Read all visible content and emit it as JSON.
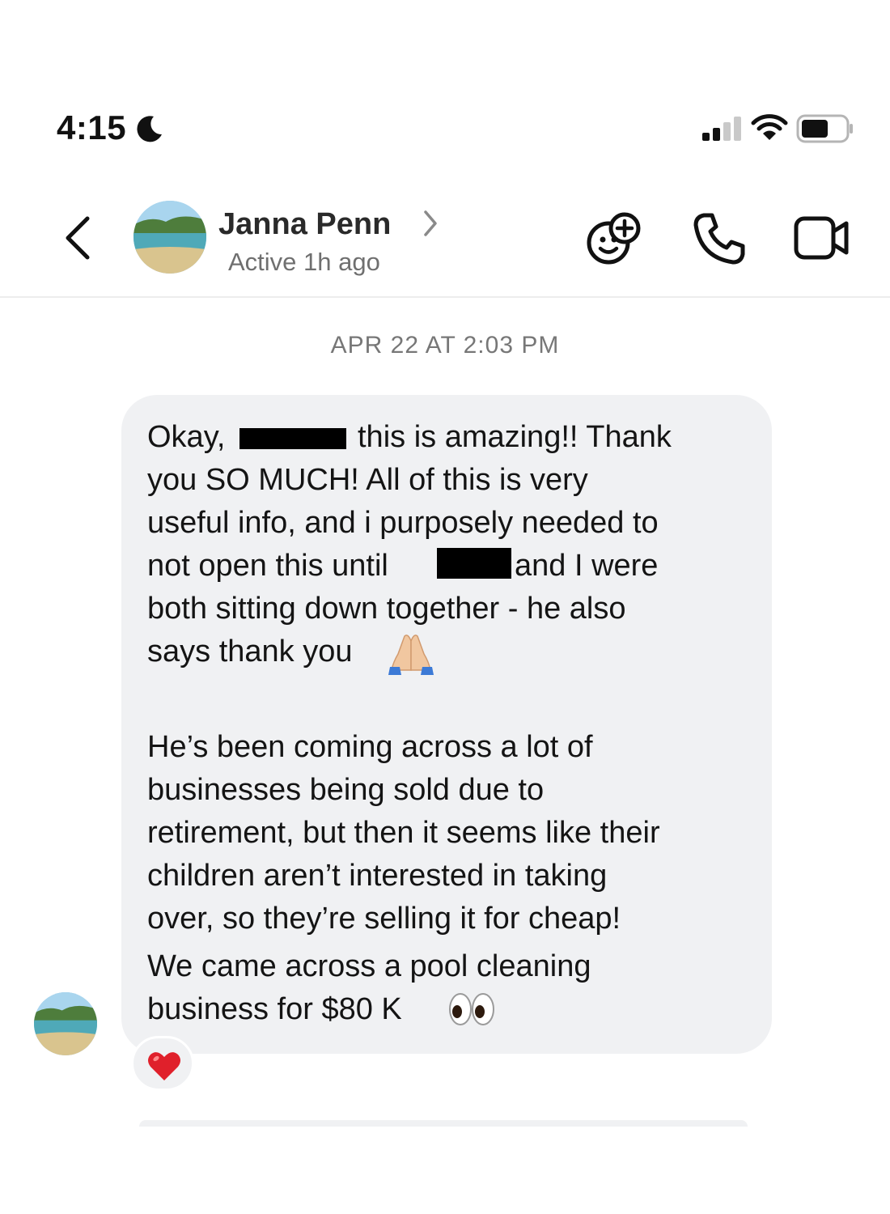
{
  "status_bar": {
    "time": "4:15",
    "icons": [
      "moon-icon",
      "signal-icon",
      "wifi-icon",
      "battery-icon"
    ]
  },
  "header": {
    "contact_name": "Janna Penn",
    "active_status": "Active 1h ago",
    "icons": [
      "back-icon",
      "chevron-right-icon",
      "effects-icon",
      "phone-icon",
      "video-icon"
    ]
  },
  "conversation": {
    "timestamp": "APR 22 AT 2:03 PM",
    "message": {
      "lines": [
        "Okay,",
        "this is amazing!! Thank",
        "you SO MUCH! All of this is very",
        "useful info, and i purposely needed to",
        "not open this until",
        "and I were",
        "both sitting down together - he also",
        "says thank you",
        "He’s been coming across a lot of",
        "businesses being sold due to",
        "retirement, but then it seems like their",
        "children aren’t interested in taking",
        "over, so they’re selling it for cheap!",
        "We came across a pool cleaning",
        "business for $80 K"
      ],
      "emojis": [
        "folded-hands-emoji",
        "eyes-emoji"
      ],
      "reaction": "heart-emoji"
    }
  },
  "colors": {
    "bubble": "#f0f1f3",
    "text": "#141414",
    "muted": "#777777",
    "heart": "#e0202b"
  }
}
